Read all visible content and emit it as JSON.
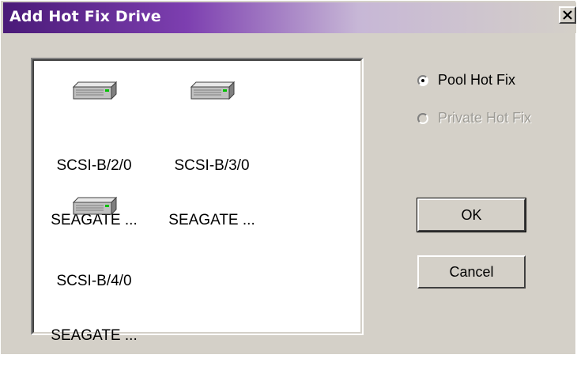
{
  "window": {
    "title": "Add Hot Fix Drive"
  },
  "drives": [
    {
      "line1": "SCSI-B/2/0",
      "line2": "SEAGATE ..."
    },
    {
      "line1": "SCSI-B/3/0",
      "line2": "SEAGATE ..."
    },
    {
      "line1": "SCSI-B/4/0",
      "line2": "SEAGATE ..."
    }
  ],
  "options": {
    "pool_hot_fix": {
      "label": "Pool Hot Fix",
      "selected": true,
      "enabled": true
    },
    "private_hot_fix": {
      "label": "Private Hot Fix",
      "selected": false,
      "enabled": false
    }
  },
  "buttons": {
    "ok_label": "OK",
    "cancel_label": "Cancel"
  },
  "icons": {
    "close": "close-icon",
    "drive": "hard-drive-icon"
  },
  "colors": {
    "title_start": "#4a1a78",
    "title_mid": "#7d3fb0",
    "dialog_face": "#d4d0c8",
    "disabled_text": "#9c9a94",
    "drive_led": "#00c000"
  }
}
